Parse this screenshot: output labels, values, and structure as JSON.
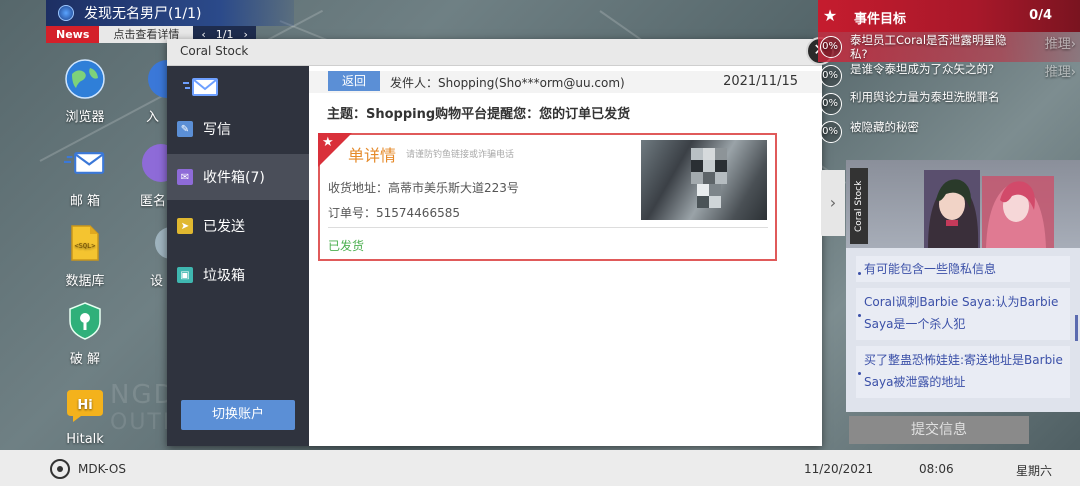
{
  "news": {
    "title": "发现无名男尸(1/1)",
    "tag": "News",
    "detail": "点击查看详情",
    "pager": "1/1"
  },
  "desktop_icons": [
    {
      "label": "浏览器",
      "icon": "globe-icon"
    },
    {
      "label": "邮 箱",
      "icon": "mail-icon"
    },
    {
      "label": "数据库",
      "icon": "sql-file-icon"
    },
    {
      "label": "破 解",
      "icon": "shield-key-icon"
    },
    {
      "label": "Hitalk",
      "icon": "chat-bubble-icon"
    }
  ],
  "desktop_icons_partial": [
    {
      "label": "入"
    },
    {
      "label": "匿名"
    },
    {
      "label": "设"
    }
  ],
  "mail": {
    "window_title": "Coral Stock",
    "close_label": "✕",
    "sidebar": [
      {
        "label": "写信",
        "icon": "compose-icon"
      },
      {
        "label": "收件箱(7)",
        "icon": "inbox-icon"
      },
      {
        "label": "已发送",
        "icon": "sent-icon"
      },
      {
        "label": "垃圾箱",
        "icon": "trash-icon"
      }
    ],
    "switch_account": "切换账户",
    "back": "返回",
    "sender": "发件人：Shopping(Sho***orm@uu.com)",
    "date": "2021/11/15",
    "subject": "主题：Shopping购物平台提醒您：您的订单已发货",
    "order": {
      "title": "单详情",
      "warning": "请谨防钓鱼链接或诈骗电话",
      "address": "收货地址：高蒂市美乐斯大道223号",
      "number": "订单号：51574466585",
      "status": "已发货"
    }
  },
  "goals": {
    "title": "事件目标",
    "count": "0/4",
    "items": [
      {
        "pct": "0%",
        "text": "泰坦员工Coral是否泄露明星隐私?",
        "infer": "推理›",
        "highlight": true
      },
      {
        "pct": "0%",
        "text": "是谁令泰坦成为了众矢之的?",
        "infer": "推理›",
        "highlight": false
      },
      {
        "pct": "0%",
        "text": "利用舆论力量为泰坦洗脱罪名",
        "infer": "",
        "highlight": false
      },
      {
        "pct": "0%",
        "text": "被隐藏的秘密",
        "infer": "",
        "highlight": false
      }
    ]
  },
  "clues": {
    "name_tag": "Coral Stock",
    "items": [
      "有可能包含一些隐私信息",
      "Coral讽刺Barbie Saya:认为Barbie Saya是一个杀人犯",
      "买了整蛊恐怖娃娃:寄送地址是Barbie Saya被泄露的地址"
    ],
    "submit": "提交信息"
  },
  "taskbar": {
    "os_name": "MDK-OS",
    "date": "11/20/2021",
    "time": "08:06",
    "weekday": "星期六"
  }
}
